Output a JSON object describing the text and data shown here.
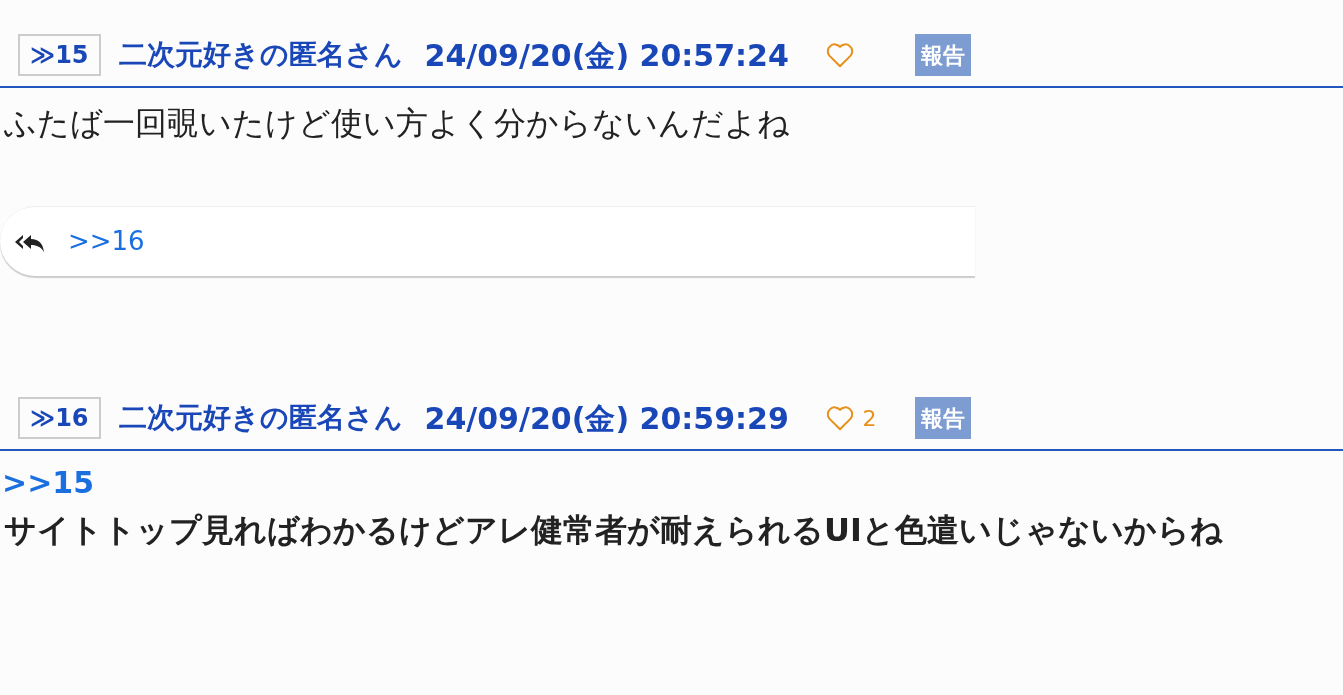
{
  "posts": [
    {
      "number": "≫15",
      "name": "二次元好きの匿名さん",
      "date": "24/09/20(金) 20:57:24",
      "report": "報告",
      "body": {
        "bold": false,
        "lines": [
          "ふたば一回覗いたけど使い方よく分からないんだよね"
        ]
      },
      "replies": [
        ">>16"
      ]
    },
    {
      "number": "≫16",
      "name": "二次元好きの匿名さん",
      "date": "24/09/20(金) 20:59:29",
      "likes": "2",
      "report": "報告",
      "body": {
        "bold": true,
        "anchor": ">>15",
        "lines": [
          "サイトトップ見ればわかるけどアレ健常者が耐えられるUIと色遣いじゃないからね"
        ]
      }
    }
  ]
}
